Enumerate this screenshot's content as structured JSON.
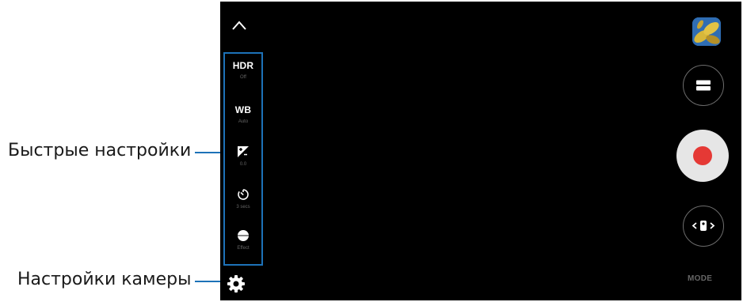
{
  "callouts": {
    "quick_settings_label": "Быстрые настройки",
    "camera_settings_label": "Настройки камеры"
  },
  "quick_settings": {
    "hdr_label": "HDR",
    "hdr_value": "Off",
    "wb_label": "WB",
    "wb_value": "Auto",
    "exposure_value": "0.0",
    "timer_value": "3 secs",
    "filter_value": "Effect"
  },
  "controls": {
    "mode_label": "MODE"
  },
  "colors": {
    "accent": "#1d72b8",
    "record": "#e53935",
    "viewfinder_bg": "#000000"
  },
  "icons": {
    "collapse": "chevron-up-icon",
    "exposure": "exposure-icon",
    "timer": "timer-icon",
    "filter": "filter-icon",
    "settings": "gear-icon",
    "gallery": "gallery-thumbnail",
    "aspect": "aspect-ratio-icon",
    "record": "record-icon",
    "switch_camera": "switch-camera-icon"
  }
}
